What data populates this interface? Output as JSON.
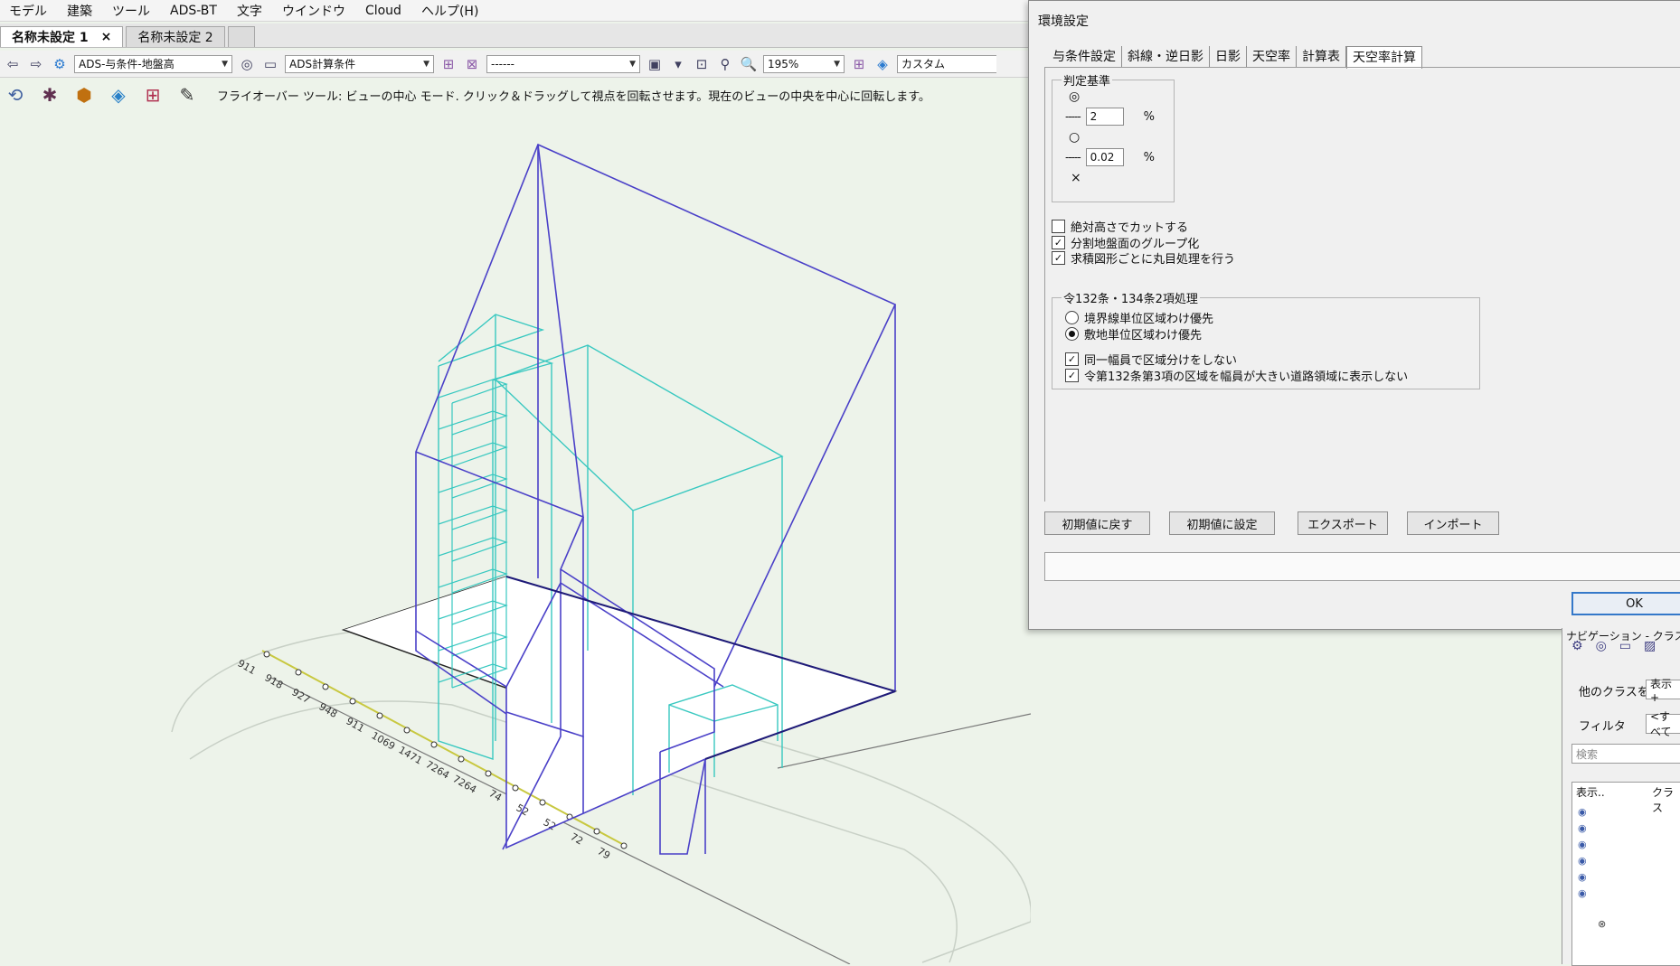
{
  "menu": [
    "モデル",
    "建築",
    "ツール",
    "ADS-BT",
    "文字",
    "ウインドウ",
    "Cloud",
    "ヘルプ(H)"
  ],
  "tabs": [
    {
      "label": "名称未設定 1",
      "close": "×"
    },
    {
      "label": "名称未設定 2"
    }
  ],
  "toolbar": {
    "layer_select": "ADS-与条件-地盤高",
    "calc_select": "ADS計算条件",
    "blank_select": "------",
    "zoom": "195%",
    "view_select": "カスタム"
  },
  "mode_hint": "フライオーバー ツール: ビューの中心 モード. クリック＆ドラッグして視点を回転させます。現在のビューの中央を中心に回転します。",
  "scale_labels": [
    "911",
    "918",
    "927",
    "948",
    "911",
    "1069",
    "1471",
    "7264",
    "7264",
    "74",
    "52",
    "52",
    "72",
    "79"
  ],
  "dialog": {
    "title": "環境設定",
    "tabs": [
      "与条件設定",
      "斜線・逆日影",
      "日影",
      "天空率",
      "計算表",
      "天空率計算"
    ],
    "active_tab": 5,
    "judgement": {
      "title": "判定基準",
      "symbols": [
        "◎",
        "○",
        "×"
      ],
      "value1": "2",
      "value2": "0.02",
      "unit": "%"
    },
    "checkboxes": [
      {
        "label": "絶対高さでカットする",
        "checked": false
      },
      {
        "label": "分割地盤面のグループ化",
        "checked": true
      },
      {
        "label": "求積図形ごとに丸目処理を行う",
        "checked": true
      }
    ],
    "article": {
      "title": "令132条・134条2項処理",
      "radios": [
        {
          "label": "境界線単位区域わけ優先",
          "selected": false
        },
        {
          "label": "敷地単位区域わけ優先",
          "selected": true
        }
      ],
      "checkboxes": [
        {
          "label": "同一幅員で区域分けをしない",
          "checked": true
        },
        {
          "label": "令第132条第3項の区域を幅員が大きい道路領域に表示しない",
          "checked": true
        }
      ]
    },
    "buttons": [
      "初期値に戻す",
      "初期値に設定",
      "エクスポート",
      "インポート"
    ],
    "ok": "OK"
  },
  "nav_panel": {
    "title": "ナビゲーション - クラス",
    "other_class_label": "他のクラスを",
    "other_class_value": "表示+",
    "filter_label": "フィルタ",
    "filter_value": "<すべて",
    "search_placeholder": "検索",
    "col_show": "表示..",
    "col_class": "クラス"
  },
  "colors": {
    "cyan_wire": "#38c8c0",
    "blue_wire": "#4a40c8",
    "navy_wire": "#1e1a78",
    "background": "#edf3ea"
  }
}
